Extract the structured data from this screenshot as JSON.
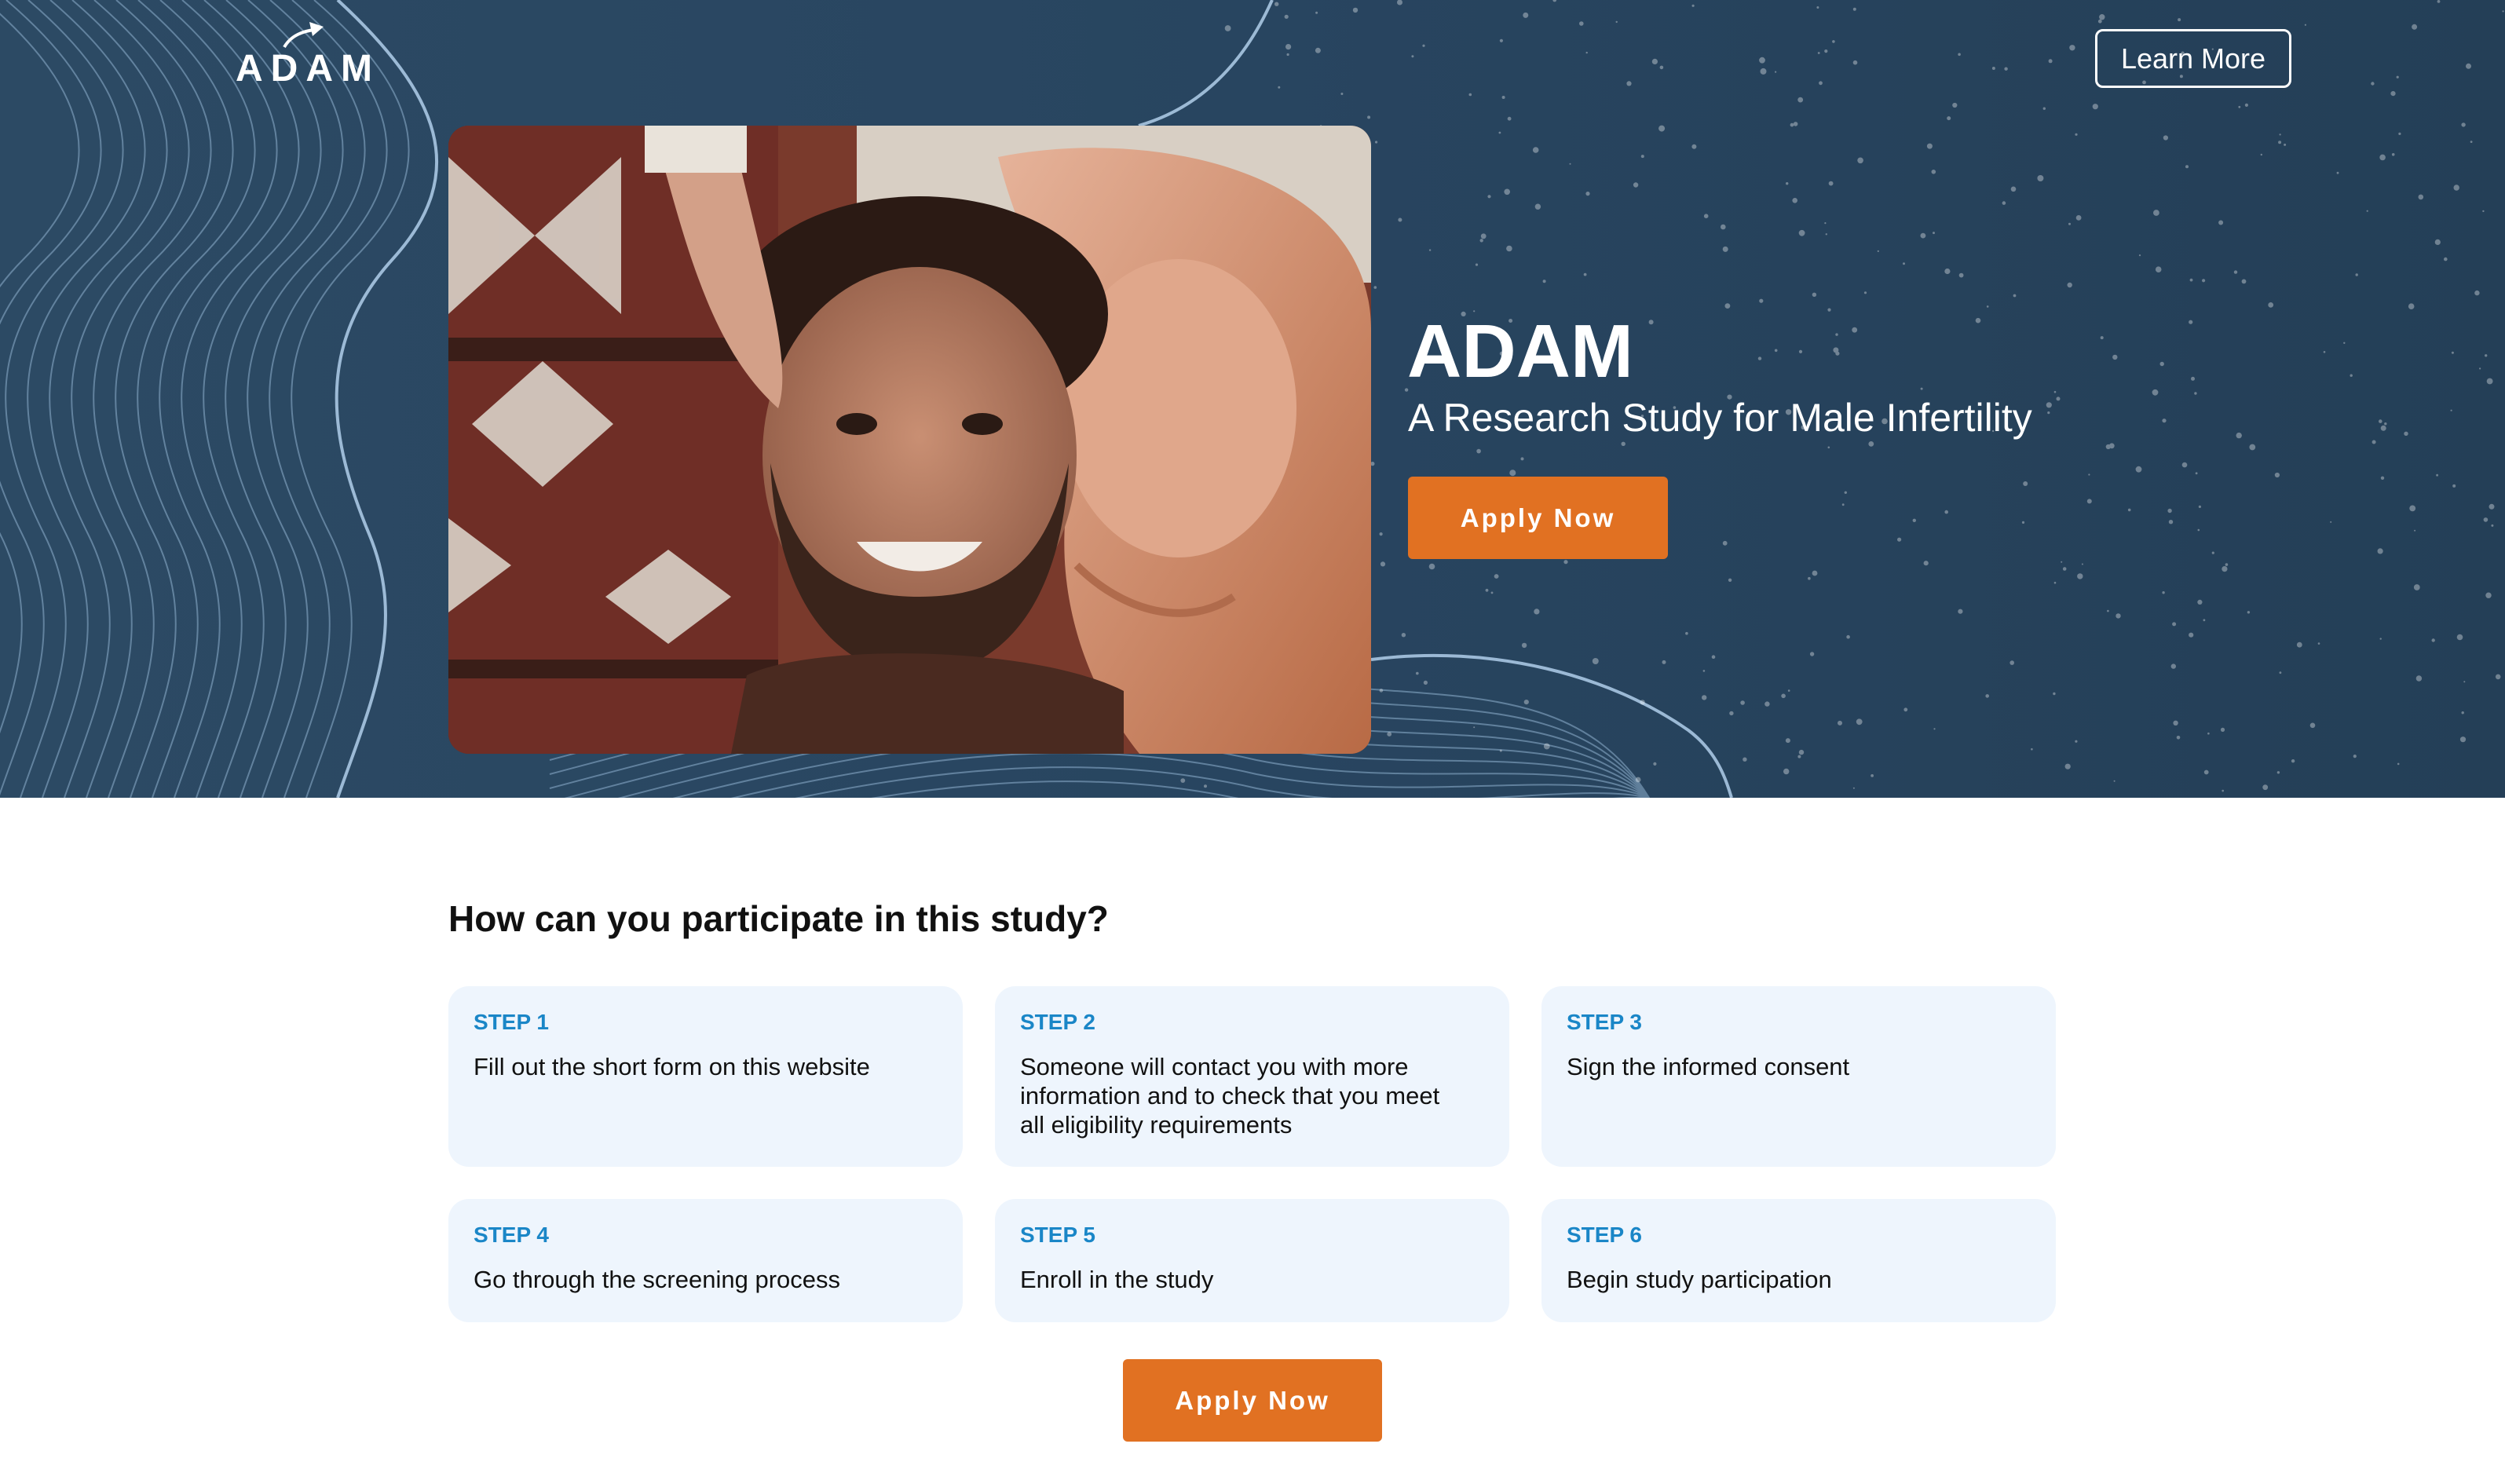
{
  "header": {
    "logo_text": "ADAM",
    "learn_more_label": "Learn More"
  },
  "hero": {
    "title": "ADAM",
    "subtitle": "A Research Study for Male Infertility",
    "apply_label": "Apply Now"
  },
  "steps_section": {
    "title": "How can you participate in this study?",
    "steps": [
      {
        "label": "STEP 1",
        "text": "Fill out the short form on this website"
      },
      {
        "label": "STEP 2",
        "text": "Someone will contact you with more information and to check that you meet all eligibility requirements"
      },
      {
        "label": "STEP 3",
        "text": "Sign the informed consent"
      },
      {
        "label": "STEP 4",
        "text": "Go through the screening process"
      },
      {
        "label": "STEP 5",
        "text": "Enroll in the study"
      },
      {
        "label": "STEP 6",
        "text": "Begin study participation"
      }
    ],
    "apply_label": "Apply Now"
  },
  "colors": {
    "hero_bg": "#284560",
    "accent": "#e17122",
    "step_label": "#1a86c7",
    "card_bg": "#eef5fd"
  }
}
